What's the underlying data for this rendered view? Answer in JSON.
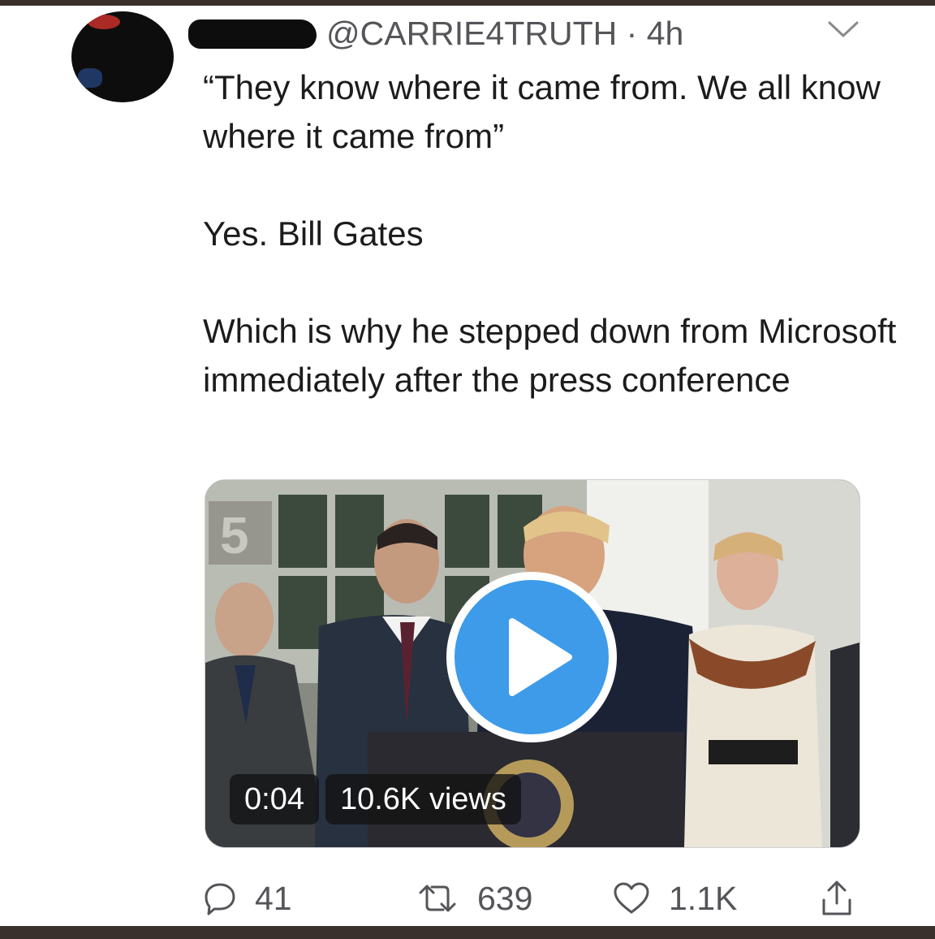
{
  "tweet": {
    "author": {
      "handle": "@CARRIE4TRUTH",
      "separator": "·",
      "time": "4h"
    },
    "text": {
      "line1": "“They know where it came from. We all know where it came from”",
      "line2": "Yes. Bill Gates",
      "line3": "Which is why he stepped down from Microsoft immediately after the press conference"
    },
    "video": {
      "duration": "0:04",
      "views": "10.6K views",
      "accent_color": "#3d9be9"
    },
    "actions": {
      "replies": "41",
      "retweets": "639",
      "likes": "1.1K"
    }
  },
  "icons": {
    "menu": "chevron-down-icon",
    "reply": "speech-bubble-icon",
    "retweet": "retweet-arrows-icon",
    "like": "heart-icon",
    "share": "share-upload-icon",
    "play": "play-icon"
  }
}
